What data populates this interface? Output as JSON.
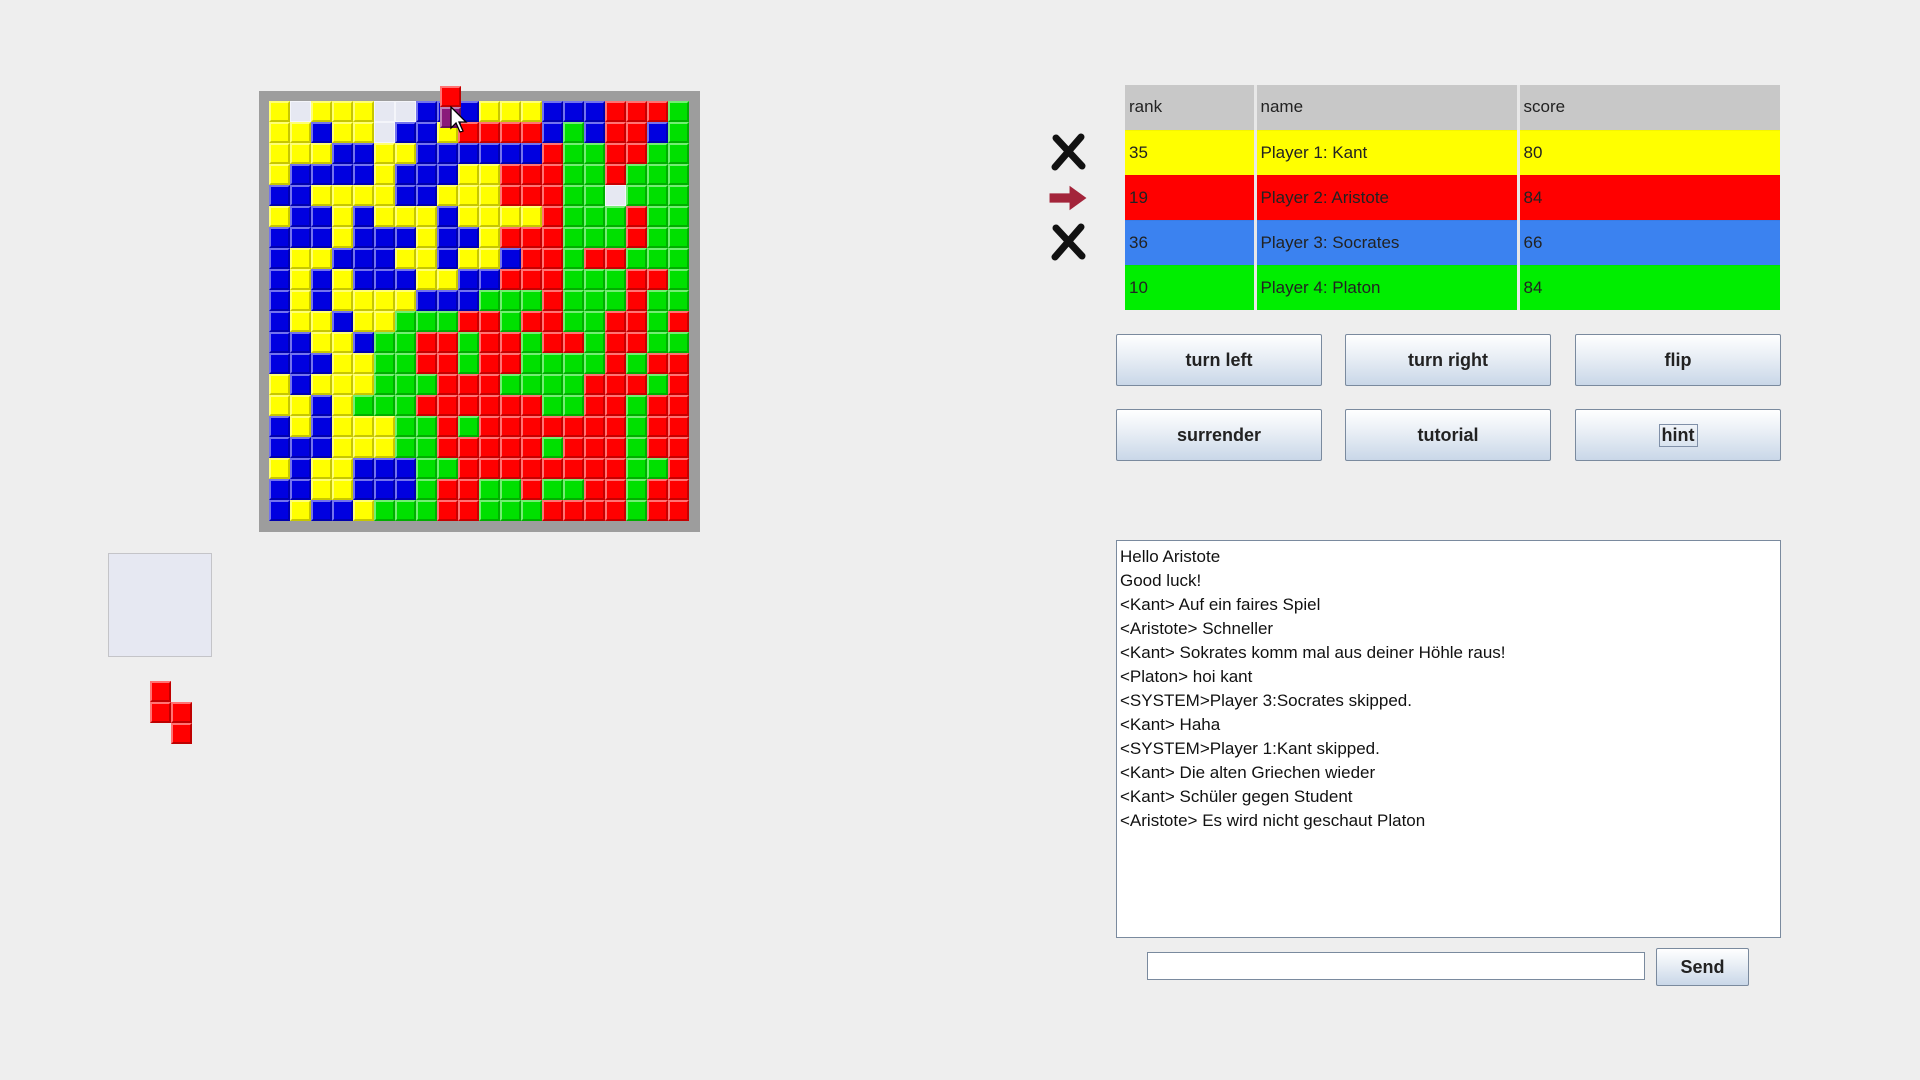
{
  "colors": {
    "yellow": "#ffff00",
    "red": "#ff0000",
    "blue": "#0000e0",
    "green": "#00e000",
    "board_frame": "#9d9d9d",
    "empty_cell": "#e6e8f2"
  },
  "board": {
    "size": 20,
    "rows": [
      "Y.YYY..BBBYYYBBBRRRG",
      "YYBYY.BBYRRRRBGBRRBG",
      "YYYBBYYBBBBBBRGGRRGG",
      "YBBBBYBBBYYRRRGGRGGG",
      "BBYYYYBBYYYRRRGG.GGG",
      "YBBYBYYYBYYYYRGGGRGG",
      "BBBYBBBYBBYRRRGGGRGG",
      "BYYBBBYYBYYBRRGRRGGG",
      "BYBYBBBYYBBRRRGGGRRG",
      "BYBYYYYBBBGGGRGGGRGG",
      "BYYBYYGGGRRGRRGGRRGR",
      "BBYYBGGRRGRRGRRGRRGG",
      "BBBYYGGRRGRRGGGGRGRR",
      "YBYYYGGGRRRGGGGRRRGR",
      "YYBYGGGRRRRRRGGRRGRR",
      "BYBYYYGGRGRRRRRRRGRR",
      "BBBYYYGGRRRRRGRRRGRR",
      "YBYYBBBGGRRRRRRRRGGR",
      "BBYYBBBGRRGGRGGRRGRR",
      "BYBBYGGGRRGGGRRRRGRR"
    ],
    "overlay_piece_color": "red"
  },
  "current_piece": {
    "color": "red",
    "cells": [
      [
        0,
        0
      ],
      [
        1,
        0
      ],
      [
        1,
        1
      ],
      [
        2,
        1
      ]
    ]
  },
  "scoreboard": {
    "headers": {
      "rank": "rank",
      "name": "name",
      "score": "score"
    },
    "rows": [
      {
        "rank": "35",
        "name": "Player 1: Kant",
        "score": "80",
        "color": "#ffff00",
        "status": "out"
      },
      {
        "rank": "19",
        "name": "Player 2: Aristote",
        "score": "84",
        "color": "#ff0000",
        "status": "current"
      },
      {
        "rank": "36",
        "name": "Player 3: Socrates",
        "score": "66",
        "color": "#3b82f0",
        "status": "out"
      },
      {
        "rank": "10",
        "name": "Player 4: Platon",
        "score": "84",
        "color": "#00ee00",
        "status": "none"
      }
    ]
  },
  "buttons": {
    "turn_left": "turn left",
    "turn_right": "turn right",
    "flip": "flip",
    "surrender": "surrender",
    "tutorial": "tutorial",
    "hint": "hint"
  },
  "chat": {
    "messages": [
      "Hello Aristote",
      "Good luck!",
      "<Kant> Auf ein faires Spiel",
      "<Aristote> Schneller",
      "<Kant> Sokrates komm mal aus deiner Höhle raus!",
      "<Platon> hoi kant",
      "<SYSTEM>Player 3:Socrates skipped.",
      "<Kant> Haha",
      "<SYSTEM>Player 1:Kant skipped.",
      "<Kant> Die alten Griechen wieder",
      "<Kant> Schüler gegen Student",
      "<Aristote> Es wird nicht geschaut Platon"
    ],
    "input_value": "",
    "send_label": "Send"
  }
}
